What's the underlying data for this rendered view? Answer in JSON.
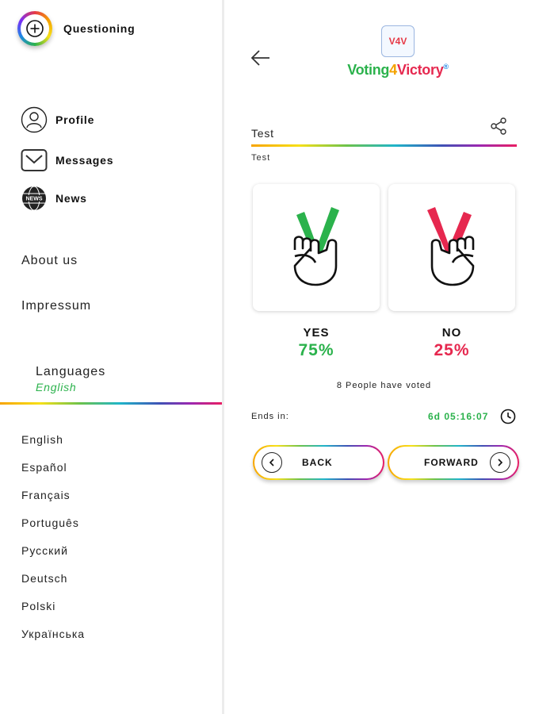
{
  "sidebar": {
    "questioning_label": "Questioning",
    "menu": [
      {
        "label": "Profile",
        "icon": "profile-icon"
      },
      {
        "label": "Messages",
        "icon": "envelope-icon"
      },
      {
        "label": "News",
        "icon": "news-globe-icon"
      }
    ],
    "about_us": "About us",
    "impressum": "Impressum",
    "languages": {
      "title": "Languages",
      "current": "English",
      "options": [
        "English",
        "Español",
        "Français",
        "Português",
        "Русский",
        "Deutsch",
        "Polski",
        "Українська"
      ]
    }
  },
  "header": {
    "logo": {
      "badge": "V4V",
      "voting": "Voting",
      "four": "4",
      "victory": "Victory",
      "registered": "®"
    }
  },
  "question": {
    "title": "Test",
    "description": "Test"
  },
  "votes": {
    "yes": {
      "label": "YES",
      "percent": "75%"
    },
    "no": {
      "label": "NO",
      "percent": "25%"
    },
    "total_text": "8 People have voted"
  },
  "ends": {
    "label": "Ends in:",
    "time": "6d 05:16:07"
  },
  "buttons": {
    "back": "BACK",
    "forward": "FORWARD"
  },
  "colors": {
    "yes_green": "#2bb24c",
    "no_red": "#e6284f",
    "accent_orange": "#f4a300"
  }
}
